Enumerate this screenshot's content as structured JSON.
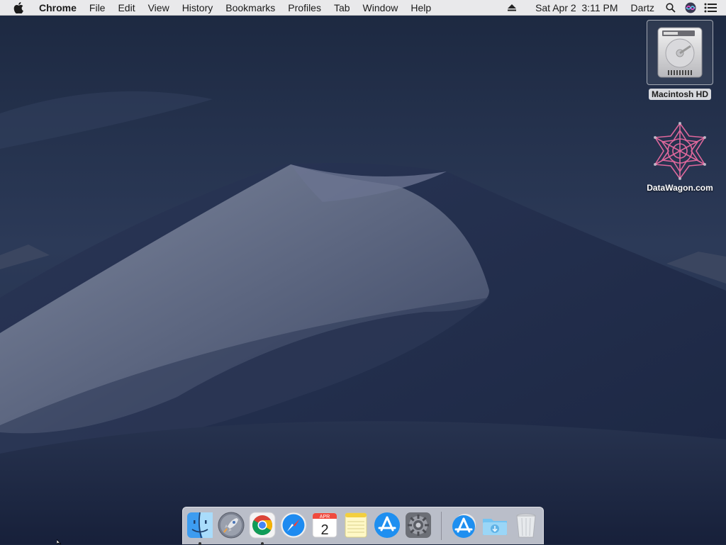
{
  "menubar": {
    "apple_icon": "apple-logo-icon",
    "app_name": "Chrome",
    "menus": [
      "File",
      "Edit",
      "View",
      "History",
      "Bookmarks",
      "Profiles",
      "Tab",
      "Window",
      "Help"
    ],
    "status": {
      "eject_icon": "eject-icon",
      "datetime": "Sat Apr 2  3:11 PM",
      "user": "Dartz",
      "search_icon": "spotlight-search-icon",
      "siri_icon": "siri-icon",
      "notifications_icon": "notification-center-icon"
    }
  },
  "desktop": {
    "icons": [
      {
        "label": "Macintosh HD",
        "icon": "hard-drive-icon",
        "selected": true
      },
      {
        "label": "DataWagon.com",
        "icon": "datawagon-logo-icon",
        "selected": false
      }
    ]
  },
  "dock": {
    "items": [
      {
        "name": "finder",
        "icon": "finder-icon",
        "running": true
      },
      {
        "name": "launchpad",
        "icon": "launchpad-rocket-icon",
        "running": false
      },
      {
        "name": "chrome",
        "icon": "chrome-icon",
        "running": true
      },
      {
        "name": "safari",
        "icon": "safari-compass-icon",
        "running": false
      },
      {
        "name": "calendar",
        "icon": "calendar-icon",
        "running": false,
        "month": "APR",
        "day": "2"
      },
      {
        "name": "notes",
        "icon": "notes-icon",
        "running": false
      },
      {
        "name": "app-store",
        "icon": "app-store-icon",
        "running": false
      },
      {
        "name": "system-preferences",
        "icon": "gear-icon",
        "running": false
      },
      {
        "name": "applications",
        "icon": "app-store-stack-icon",
        "running": false
      },
      {
        "name": "downloads",
        "icon": "downloads-folder-icon",
        "running": false
      },
      {
        "name": "trash",
        "icon": "trash-icon",
        "running": false
      }
    ]
  },
  "colors": {
    "menubar_bg": "#e9e9eb",
    "sky": "#1f2d4a",
    "dune": "#56607a"
  }
}
